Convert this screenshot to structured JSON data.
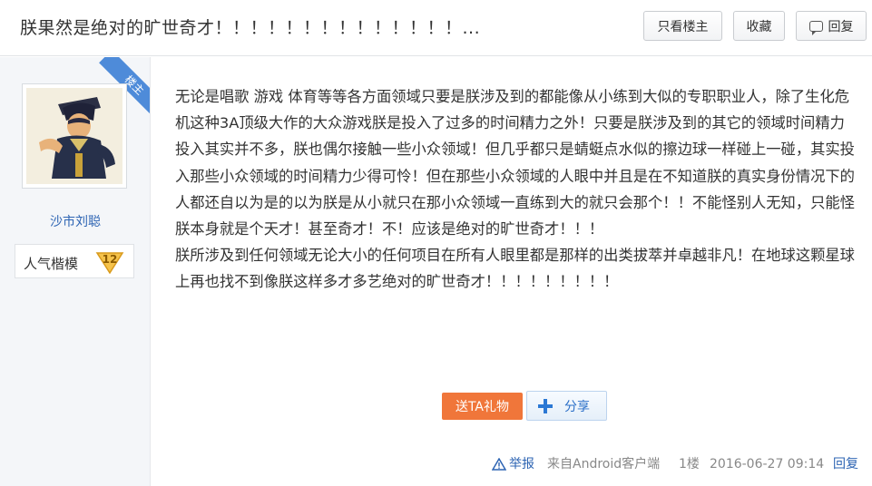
{
  "header": {
    "title": "朕果然是绝对的旷世奇才！！！！！！！！！！！！！！...",
    "only_op_label": "只看楼主",
    "favorite_label": "收藏",
    "reply_label": "回复"
  },
  "author": {
    "ribbon": "楼主",
    "name": "沙市刘聪",
    "level_title": "人气楷模",
    "level": "12",
    "avatar": "avatar-image"
  },
  "post": {
    "paragraphs": [
      "无论是唱歌 游戏 体育等等各方面领域只要是朕涉及到的都能像从小练到大似的专职职业人，除了生化危机这种3A顶级大作的大众游戏朕是投入了过多的时间精力之外！只要是朕涉及到的其它的领域时间精力投入其实并不多，朕也偶尔接触一些小众领域！但几乎都只是蜻蜓点水似的擦边球一样碰上一碰，其实投入那些小众领域的时间精力少得可怜！但在那些小众领域的人眼中并且是在不知道朕的真实身份情况下的人都还自以为是的以为朕是从小就只在那小众领域一直练到大的就只会那个！！不能怪别人无知，只能怪朕本身就是个天才！甚至奇才！不！应该是绝对的旷世奇才！！！",
      "朕所涉及到任何领域无论大小的任何项目在所有人眼里都是那样的出类拔萃并卓越非凡！在地球这颗星球上再也找不到像朕这样多才多艺绝对的旷世奇才！！！！！！！！！"
    ],
    "gift_label": "送TA礼物",
    "share_label": "分享"
  },
  "footer": {
    "report_label": "举报",
    "client": "来自Android客户端",
    "floor": "1楼",
    "time": "2016-06-27 09:14",
    "reply_label": "回复"
  },
  "colors": {
    "link": "#2d64b3",
    "ribbon": "#4e8bd9",
    "gift": "#f0763a",
    "share": "#2b78d4",
    "badge": "#f5c24a"
  }
}
